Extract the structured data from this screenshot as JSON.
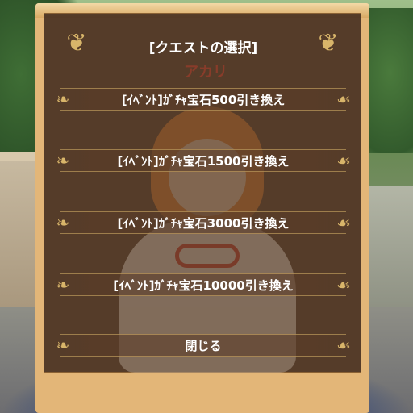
{
  "dialog": {
    "title": "[クエストの選択]",
    "ghost_name": "アカリ",
    "options": [
      {
        "label": "[ｲﾍﾞﾝﾄ]ｶﾞﾁｬ宝石500引き換え"
      },
      {
        "label": "[ｲﾍﾞﾝﾄ]ｶﾞﾁｬ宝石1500引き換え"
      },
      {
        "label": "[ｲﾍﾞﾝﾄ]ｶﾞﾁｬ宝石3000引き換え"
      },
      {
        "label": "[ｲﾍﾞﾝﾄ]ｶﾞﾁｬ宝石10000引き換え"
      }
    ],
    "close_label": "閉じる"
  },
  "icons": {
    "corner_ornament": "ornament-icon",
    "option_ornament": "fleur-icon"
  },
  "colors": {
    "panel_frame": "#e3b678",
    "panel_inner": "#3e281c",
    "ornament": "#d8b56a",
    "text": "#ffffff"
  }
}
